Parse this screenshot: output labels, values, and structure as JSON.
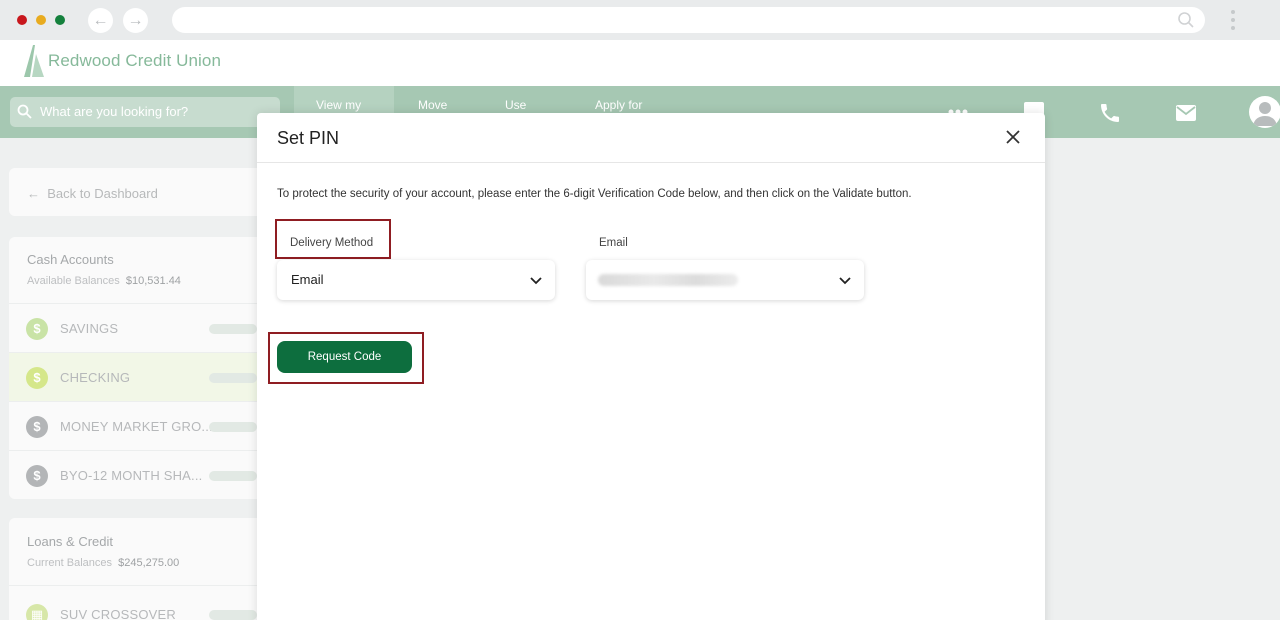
{
  "brand": {
    "name": "Redwood Credit Union"
  },
  "search": {
    "placeholder": "What are you looking for?"
  },
  "nav": {
    "items": [
      "View my",
      "Move",
      "Use",
      "Apply for"
    ]
  },
  "sidebar": {
    "back_label": "Back to Dashboard",
    "cash": {
      "heading": "Cash Accounts",
      "balance_label": "Available Balances",
      "balance_value": "$10,531.44",
      "accounts": [
        "SAVINGS",
        "CHECKING",
        "MONEY MARKET GRO...",
        "BYO-12 MONTH SHA..."
      ]
    },
    "loans": {
      "heading": "Loans & Credit",
      "balance_label": "Current Balances",
      "balance_value": "$245,275.00",
      "accounts": [
        "SUV CROSSOVER"
      ]
    }
  },
  "modal": {
    "title": "Set PIN",
    "instructions": "To protect the security of your account, please enter the 6-digit Verification Code below, and then click on the Validate button.",
    "delivery_label": "Delivery Method",
    "delivery_value": "Email",
    "email_label": "Email",
    "request_button": "Request Code"
  },
  "colors": {
    "nav_green": "#a6c8b3",
    "button_green": "#0d6e3e",
    "highlight": "#8f1d22"
  }
}
